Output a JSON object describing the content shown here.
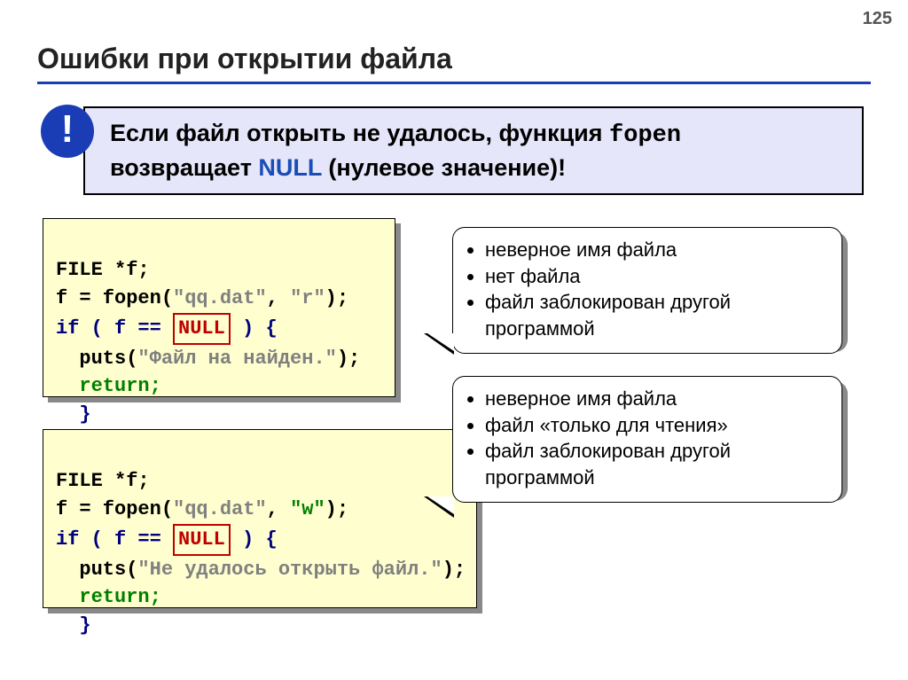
{
  "page_number": "125",
  "title": "Ошибки при открытии файла",
  "badge": "!",
  "callout": {
    "part1": "Если файл открыть не удалось, функция ",
    "fopen": "fopen",
    "part2": "возвращает ",
    "null": "NULL",
    "part3": " (нулевое значение)!"
  },
  "code1": {
    "l1a": "FILE *f;",
    "l2a": "f = fopen(",
    "l2b": "\"qq.dat\"",
    "l2c": ", ",
    "l2d": "\"r\"",
    "l2e": ");",
    "l3a": "if ( f == ",
    "l3null": "NULL",
    "l3b": " ) {",
    "l4a": "  puts(",
    "l4b": "\"Файл на найден.\"",
    "l4c": ");",
    "l5": "  return;",
    "l6": "  }"
  },
  "code2": {
    "l1a": "FILE *f;",
    "l2a": "f = fopen(",
    "l2b": "\"qq.dat\"",
    "l2c": ", ",
    "l2d": "\"w\"",
    "l2e": ");",
    "l3a": "if ( f == ",
    "l3null": "NULL",
    "l3b": " ) {",
    "l4a": "  puts(",
    "l4b": "\"Не удалось открыть файл.\"",
    "l4c": ");",
    "l5": "  return;",
    "l6": "  }"
  },
  "bubble1": {
    "items": [
      "неверное имя файла",
      "нет файла",
      "файл заблокирован другой программой"
    ]
  },
  "bubble2": {
    "items": [
      "неверное имя файла",
      "файл «только для чтения»",
      "файл заблокирован другой программой"
    ]
  }
}
